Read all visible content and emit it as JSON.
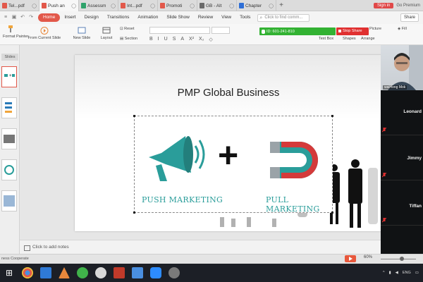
{
  "tabs": [
    {
      "label": "Tel...pdf",
      "color": "#e2584a"
    },
    {
      "label": "Push an",
      "color": "#e2584a",
      "active": true
    },
    {
      "label": "Assessm",
      "color": "#2fa36b"
    },
    {
      "label": "Int...pdf",
      "color": "#e2584a"
    },
    {
      "label": "Promoti",
      "color": "#e2584a"
    },
    {
      "label": "GB - Alt",
      "color": "#6a6a6a"
    },
    {
      "label": "Chapter",
      "color": "#2f6fd6"
    }
  ],
  "window": {
    "sign_in": "Sign in",
    "premium": "Go Premium"
  },
  "menu": {
    "items": [
      "Home",
      "Insert",
      "Design",
      "Transitions",
      "Animation",
      "Slide Show",
      "Review",
      "View",
      "Tools"
    ],
    "find_placeholder": "Click to find comm...",
    "share": "Share"
  },
  "toolbar": {
    "format_painter": "Format Painter",
    "from_current": "From Current Slide",
    "new_slide": "New Slide",
    "layout": "Layout",
    "reset": "Reset",
    "section": "Section",
    "picture": "Picture",
    "fill": "Fill",
    "text_box": "Text Box",
    "shapes": "Shapes",
    "arrange": "Arrange",
    "format_buttons": [
      "B",
      "I",
      "U",
      "S",
      "A",
      "X²",
      "X₂",
      "◇"
    ]
  },
  "call": {
    "id_label": "ID: 601-241-810",
    "stop_share": "Stop Share"
  },
  "side_panel": {
    "tab_label": "Slides"
  },
  "slide": {
    "title": "PMP Global Business",
    "push_label": "PUSH MARKETING",
    "pull_label": "PULL MARKETING",
    "plus": "+"
  },
  "notes_placeholder": "Click to add notes",
  "status": {
    "left_text": "ness Cooperate",
    "zoom": "60%"
  },
  "participants": [
    {
      "name": "waiHong Mok",
      "video": true
    },
    {
      "name": "Leonard",
      "video": false
    },
    {
      "name": "Jimmy",
      "video": false
    },
    {
      "name": "Tiffan",
      "video": false
    }
  ],
  "tray": {
    "lang": "ENG"
  },
  "colors": {
    "accent": "#e2584a",
    "teal": "#2a9d9a",
    "call_green": "#33b233",
    "stop_red": "#e03030"
  }
}
